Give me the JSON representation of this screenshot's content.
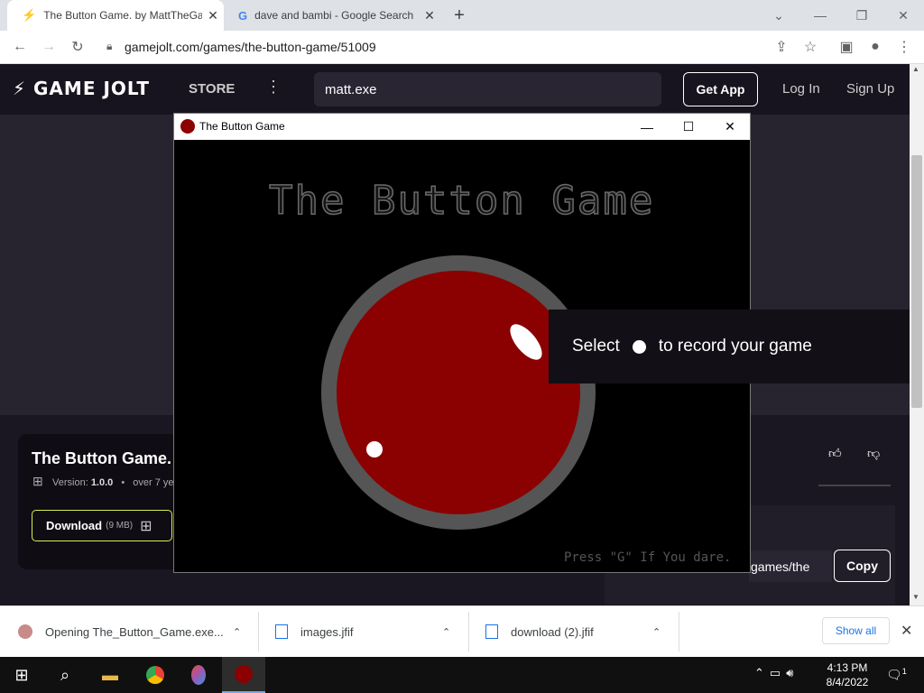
{
  "browser": {
    "tabs": [
      {
        "title": "The Button Game. by MattTheGa",
        "active": true
      },
      {
        "title": "dave and bambi - Google Search",
        "active": false
      }
    ],
    "new_tab": "+",
    "url": "gamejolt.com/games/the-button-game/51009"
  },
  "gamejolt": {
    "logo": "GAME JOLT",
    "store": "STORE",
    "search_value": "matt.exe",
    "get_app": "Get App",
    "log_in": "Log In",
    "sign_up": "Sign Up",
    "game_title": "The Button Game.",
    "version_label": "Version:",
    "version_value": "1.0.0",
    "age": "over 7 ye",
    "download_label": "Download",
    "download_size": "(9 MB)",
    "share_url_fragment": "games/the",
    "copy": "Copy"
  },
  "game_window": {
    "title": "The Button Game",
    "heading": "The Button Game",
    "hint": "Press \"G\" If You dare.",
    "button_color": "#8b0000",
    "ring_color": "#555555"
  },
  "record_overlay": {
    "before": "Select",
    "after": "to record your game"
  },
  "downloads": {
    "items": [
      {
        "name": "Opening The_Button_Game.exe..."
      },
      {
        "name": "images.jfif"
      },
      {
        "name": "download (2).jfif"
      }
    ],
    "show_all": "Show all"
  },
  "taskbar": {
    "time": "4:13 PM",
    "date": "8/4/2022",
    "notifications": "1"
  }
}
